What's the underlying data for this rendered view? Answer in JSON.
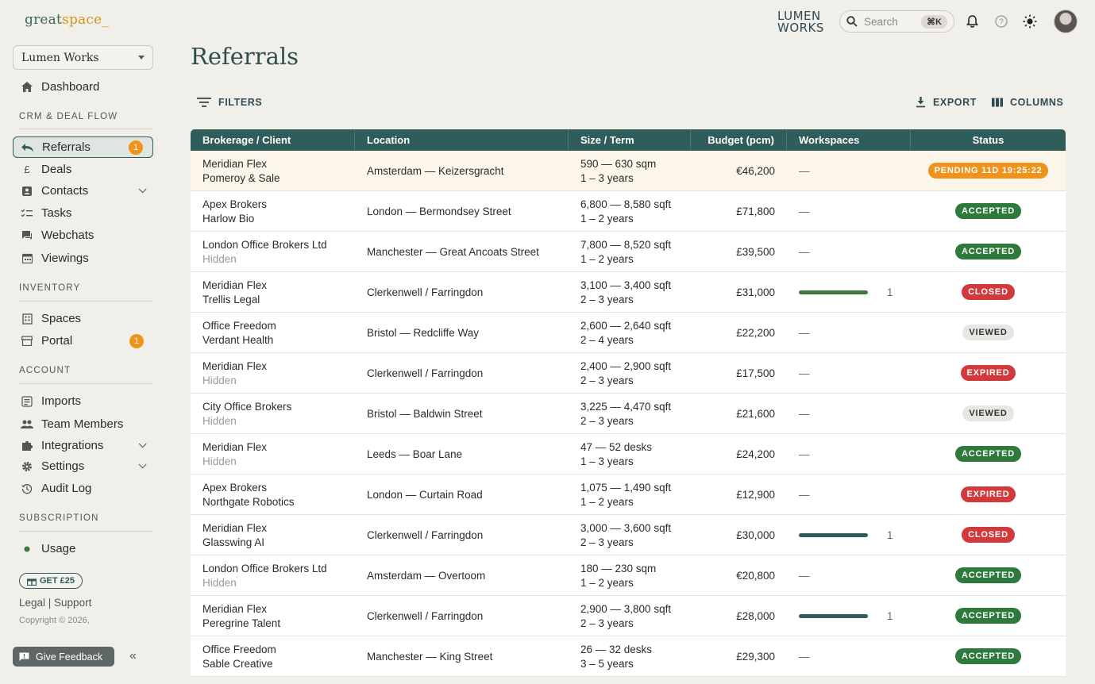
{
  "brand": {
    "name_part1": "great",
    "name_part2": "space_"
  },
  "workspace": {
    "selected": "Lumen Works"
  },
  "nav": {
    "dashboard": "Dashboard",
    "section_crm": "CRM & DEAL FLOW",
    "referrals": "Referrals",
    "referrals_count": "1",
    "deals": "Deals",
    "contacts": "Contacts",
    "tasks": "Tasks",
    "webchats": "Webchats",
    "viewings": "Viewings",
    "section_inventory": "INVENTORY",
    "spaces": "Spaces",
    "portal": "Portal",
    "portal_count": "1",
    "section_account": "ACCOUNT",
    "imports": "Imports",
    "team_members": "Team Members",
    "integrations": "Integrations",
    "settings": "Settings",
    "audit_log": "Audit Log",
    "section_subscription": "SUBSCRIPTION",
    "usage": "Usage"
  },
  "promo": "GET £25",
  "legal": "Legal | Support",
  "copyright": "Copyright © 2026,",
  "feedback": "Give Feedback",
  "topbar": {
    "logo_line1": "LUMEN",
    "logo_line2": "WORKS",
    "search_placeholder": "Search",
    "search_shortcut": "⌘K"
  },
  "page": {
    "title": "Referrals"
  },
  "toolbar": {
    "filters": "FILTERS",
    "export": "EXPORT",
    "columns": "COLUMNS"
  },
  "table": {
    "headers": [
      "Brokerage / Client",
      "Location",
      "Size / Term",
      "Budget (pcm)",
      "Workspaces",
      "Status"
    ],
    "rows": [
      {
        "brokerage": "Meridian Flex",
        "client": "Pomeroy & Sale",
        "client_hidden": false,
        "location": "Amsterdam — Keizersgracht",
        "size": "590 — 630 sqm",
        "term": "1 – 3 years",
        "budget": "€46,200",
        "workspaces": "—",
        "status": "PENDING 11D 19:25:22",
        "status_type": "pending"
      },
      {
        "brokerage": "Apex Brokers",
        "client": "Harlow Bio",
        "client_hidden": false,
        "location": "London — Bermondsey Street",
        "size": "6,800 — 8,580 sqft",
        "term": "1 – 2 years",
        "budget": "£71,800",
        "workspaces": "—",
        "status": "ACCEPTED",
        "status_type": "accepted"
      },
      {
        "brokerage": "London Office Brokers Ltd",
        "client": "Hidden",
        "client_hidden": true,
        "location": "Manchester — Great Ancoats Street",
        "size": "7,800 — 8,520 sqft",
        "term": "1 – 2 years",
        "budget": "£39,500",
        "workspaces": "—",
        "status": "ACCEPTED",
        "status_type": "accepted"
      },
      {
        "brokerage": "Meridian Flex",
        "client": "Trellis Legal",
        "client_hidden": false,
        "location": "Clerkenwell / Farringdon",
        "size": "3,100 — 3,400 sqft",
        "term": "2 – 3 years",
        "budget": "£31,000",
        "workspaces": "1",
        "bar_color": "green",
        "status": "CLOSED",
        "status_type": "closed"
      },
      {
        "brokerage": "Office Freedom",
        "client": "Verdant Health",
        "client_hidden": false,
        "location": "Bristol — Redcliffe Way",
        "size": "2,600 — 2,640 sqft",
        "term": "2 – 4 years",
        "budget": "£22,200",
        "workspaces": "—",
        "status": "VIEWED",
        "status_type": "viewed"
      },
      {
        "brokerage": "Meridian Flex",
        "client": "Hidden",
        "client_hidden": true,
        "location": "Clerkenwell / Farringdon",
        "size": "2,400 — 2,900 sqft",
        "term": "2 – 3 years",
        "budget": "£17,500",
        "workspaces": "—",
        "status": "EXPIRED",
        "status_type": "expired"
      },
      {
        "brokerage": "City Office Brokers",
        "client": "Hidden",
        "client_hidden": true,
        "location": "Bristol — Baldwin Street",
        "size": "3,225 — 4,470 sqft",
        "term": "2 – 3 years",
        "budget": "£21,600",
        "workspaces": "—",
        "status": "VIEWED",
        "status_type": "viewed"
      },
      {
        "brokerage": "Meridian Flex",
        "client": "Hidden",
        "client_hidden": true,
        "location": "Leeds — Boar Lane",
        "size": "47 — 52 desks",
        "term": "1 – 3 years",
        "budget": "£24,200",
        "workspaces": "—",
        "status": "ACCEPTED",
        "status_type": "accepted"
      },
      {
        "brokerage": "Apex Brokers",
        "client": "Northgate Robotics",
        "client_hidden": false,
        "location": "London — Curtain Road",
        "size": "1,075 — 1,490 sqft",
        "term": "1 – 2 years",
        "budget": "£12,900",
        "workspaces": "—",
        "status": "EXPIRED",
        "status_type": "expired"
      },
      {
        "brokerage": "Meridian Flex",
        "client": "Glasswing AI",
        "client_hidden": false,
        "location": "Clerkenwell / Farringdon",
        "size": "3,000 — 3,600 sqft",
        "term": "2 – 3 years",
        "budget": "£30,000",
        "workspaces": "1",
        "bar_color": "teal",
        "status": "CLOSED",
        "status_type": "closed"
      },
      {
        "brokerage": "London Office Brokers Ltd",
        "client": "Hidden",
        "client_hidden": true,
        "location": "Amsterdam — Overtoom",
        "size": "180 — 230 sqm",
        "term": "1 – 2 years",
        "budget": "€20,800",
        "workspaces": "—",
        "status": "ACCEPTED",
        "status_type": "accepted"
      },
      {
        "brokerage": "Meridian Flex",
        "client": "Peregrine Talent",
        "client_hidden": false,
        "location": "Clerkenwell / Farringdon",
        "size": "2,900 — 3,800 sqft",
        "term": "2 – 3 years",
        "budget": "£28,000",
        "workspaces": "1",
        "bar_color": "teal",
        "status": "ACCEPTED",
        "status_type": "accepted"
      },
      {
        "brokerage": "Office Freedom",
        "client": "Sable Creative",
        "client_hidden": false,
        "location": "Manchester — King Street",
        "size": "26 — 32 desks",
        "term": "3 – 5 years",
        "budget": "£29,300",
        "workspaces": "—",
        "status": "ACCEPTED",
        "status_type": "accepted"
      }
    ]
  }
}
